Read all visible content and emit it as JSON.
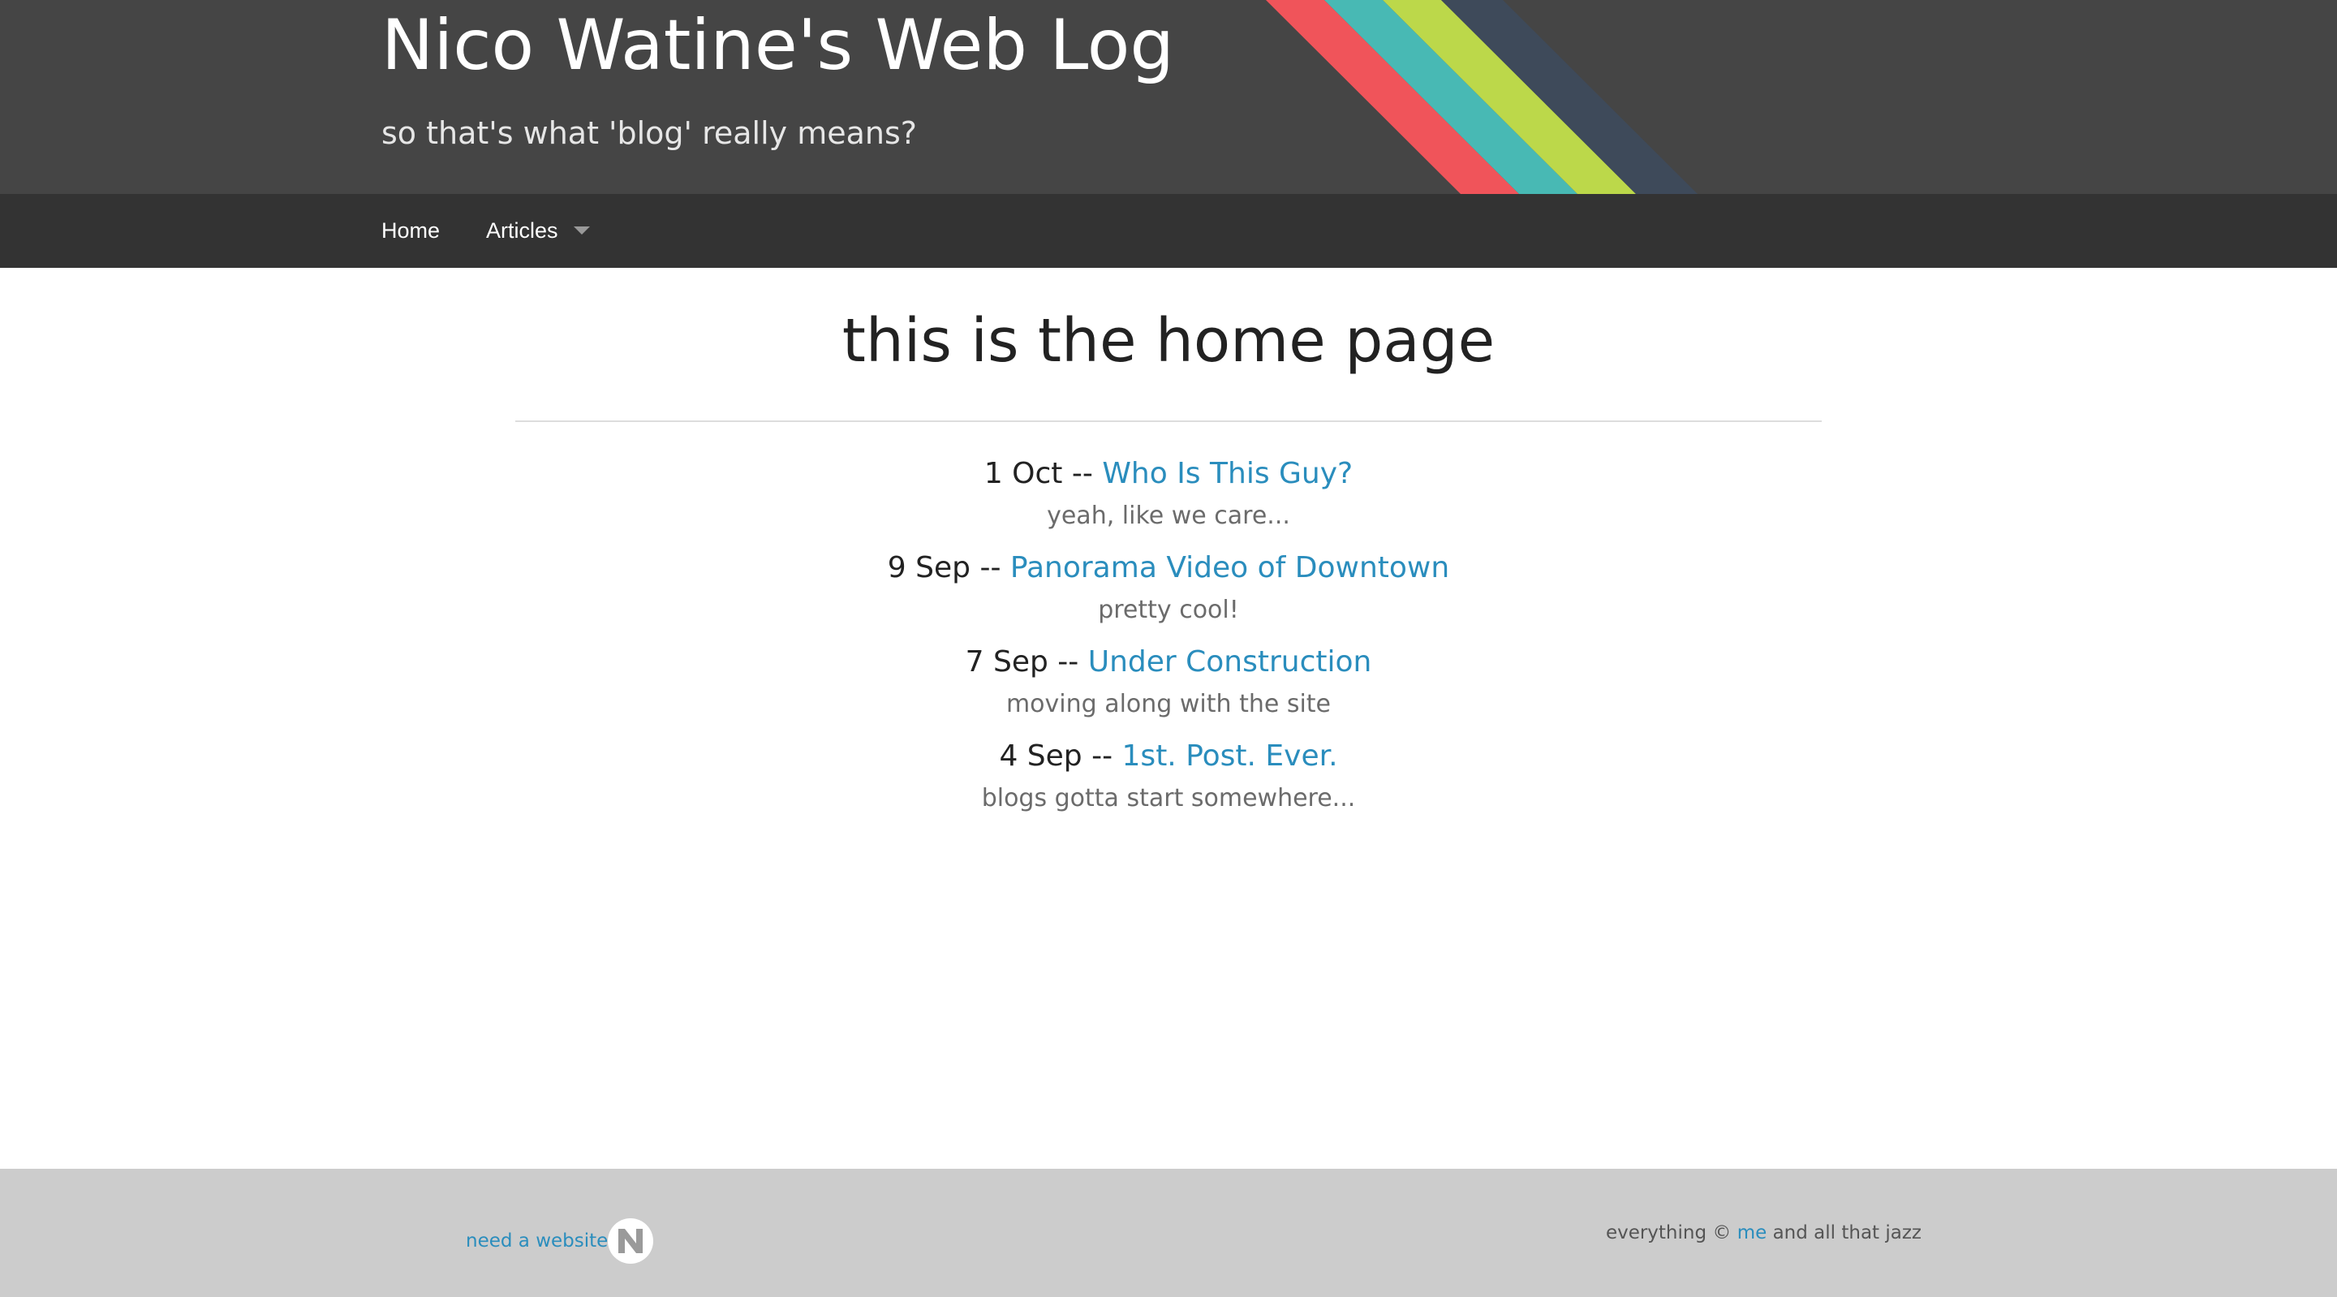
{
  "header": {
    "title": "Nico Watine's Web Log",
    "tagline": "so that's what 'blog' really means?",
    "background_color": "#454545",
    "stripe_colors": [
      "#f0545a",
      "#48b9b4",
      "#bcd84a",
      "#3e4a5a"
    ]
  },
  "nav": {
    "items": [
      {
        "label": "Home"
      },
      {
        "label": "Articles",
        "has_dropdown": true
      }
    ],
    "background_color": "#333333"
  },
  "main": {
    "page_title": "this is the home page",
    "separator": "--",
    "posts": [
      {
        "date": "1 Oct",
        "title": "Who Is This Guy?",
        "excerpt": "yeah, like we care..."
      },
      {
        "date": "9 Sep",
        "title": "Panorama Video of Downtown",
        "excerpt": "pretty cool!"
      },
      {
        "date": "7 Sep",
        "title": "Under Construction",
        "excerpt": "moving along with the site"
      },
      {
        "date": "4 Sep",
        "title": "1st. Post. Ever.",
        "excerpt": "blogs gotta start somewhere..."
      }
    ],
    "link_color": "#2a8dbd"
  },
  "footer": {
    "left_link": "need a website?",
    "logo_icon": "n-logo-icon",
    "right_prefix": "everything ©",
    "right_link": "me",
    "right_suffix": "and all that jazz",
    "background_color": "#cccccc"
  }
}
